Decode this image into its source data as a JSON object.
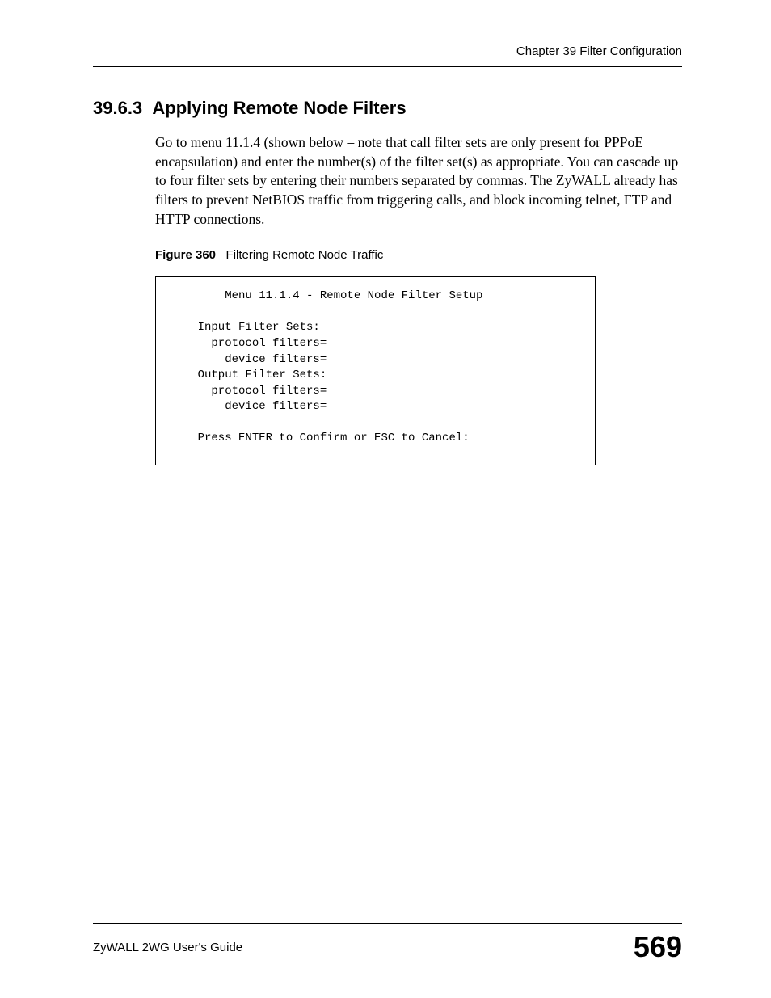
{
  "header": {
    "chapter": "Chapter 39 Filter Configuration"
  },
  "section": {
    "number": "39.6.3",
    "title": "Applying Remote Node Filters"
  },
  "paragraph": "Go to menu 11.1.4 (shown below – note that call filter sets are only present for PPPoE encapsulation) and enter the number(s) of the filter set(s) as appropriate. You can cascade up to four filter sets by entering their numbers separated by commas. The ZyWALL already has filters to prevent NetBIOS traffic from triggering calls, and block incoming telnet, FTP and HTTP connections.",
  "figure": {
    "label": "Figure 360",
    "caption": "Filtering Remote Node Traffic"
  },
  "terminal": "        Menu 11.1.4 - Remote Node Filter Setup\n\n    Input Filter Sets:\n      protocol filters=\n        device filters=\n    Output Filter Sets:\n      protocol filters=\n        device filters=\n\n    Press ENTER to Confirm or ESC to Cancel:",
  "footer": {
    "guide": "ZyWALL 2WG User's Guide",
    "page": "569"
  }
}
